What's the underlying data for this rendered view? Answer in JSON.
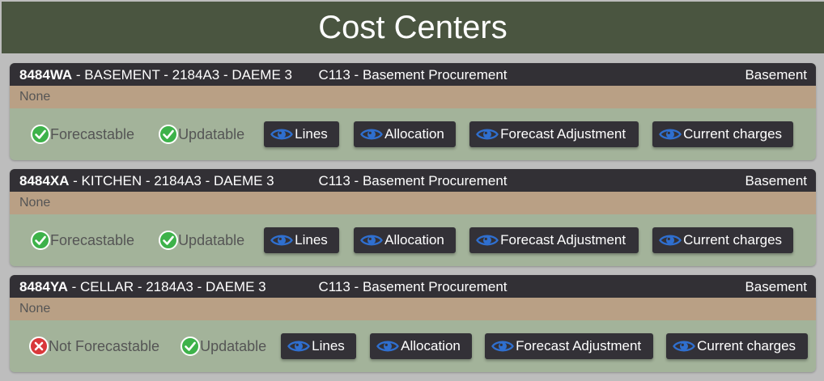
{
  "page_title": "Cost Centers",
  "colors": {
    "title_bg": "#4a5540",
    "header_bg": "#323035",
    "note_bg": "#b9a085",
    "actions_bg": "#a3b39a",
    "check_green": "#3db24a",
    "cross_red": "#d9383a",
    "eye_blue": "#2f6fcf"
  },
  "cost_centers": [
    {
      "code": "8484WA",
      "description": " - BASEMENT - 2184A3 - DAEME 3",
      "procurement": "C113 - Basement Procurement",
      "location": "Basement",
      "note": "None",
      "forecast_status": {
        "icon": "check-circle-icon",
        "label": "Forecastable"
      },
      "update_status": {
        "icon": "check-circle-icon",
        "label": "Updatable"
      },
      "buttons": {
        "lines": "Lines",
        "allocation": "Allocation",
        "forecast_adjustment": "Forecast Adjustment",
        "current_charges": "Current charges"
      }
    },
    {
      "code": "8484XA",
      "description": " - KITCHEN - 2184A3 - DAEME 3",
      "procurement": "C113 - Basement Procurement",
      "location": "Basement",
      "note": "None",
      "forecast_status": {
        "icon": "check-circle-icon",
        "label": "Forecastable"
      },
      "update_status": {
        "icon": "check-circle-icon",
        "label": "Updatable"
      },
      "buttons": {
        "lines": "Lines",
        "allocation": "Allocation",
        "forecast_adjustment": "Forecast Adjustment",
        "current_charges": "Current charges"
      }
    },
    {
      "code": "8484YA",
      "description": " - CELLAR - 2184A3 - DAEME 3",
      "procurement": "C113 - Basement Procurement",
      "location": "Basement",
      "note": "None",
      "forecast_status": {
        "icon": "x-circle-icon",
        "label": "Not Forecastable"
      },
      "update_status": {
        "icon": "check-circle-icon",
        "label": "Updatable"
      },
      "buttons": {
        "lines": "Lines",
        "allocation": "Allocation",
        "forecast_adjustment": "Forecast Adjustment",
        "current_charges": "Current charges"
      }
    }
  ]
}
